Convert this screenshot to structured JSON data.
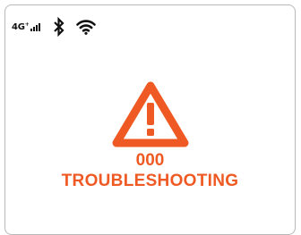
{
  "status_bar": {
    "network_type": "4G",
    "network_suffix": "+",
    "signal_icon": "signal-bars-icon",
    "signal_strength": 4,
    "bluetooth_icon": "bluetooth-icon",
    "wifi_icon": "wifi-icon"
  },
  "alert": {
    "icon": "warning-triangle-icon",
    "code": "000",
    "message": "TROUBLESHOOTING"
  },
  "colors": {
    "accent": "#ef5a24",
    "text": "#111111",
    "border": "#b8b8b8",
    "background": "#ffffff"
  }
}
